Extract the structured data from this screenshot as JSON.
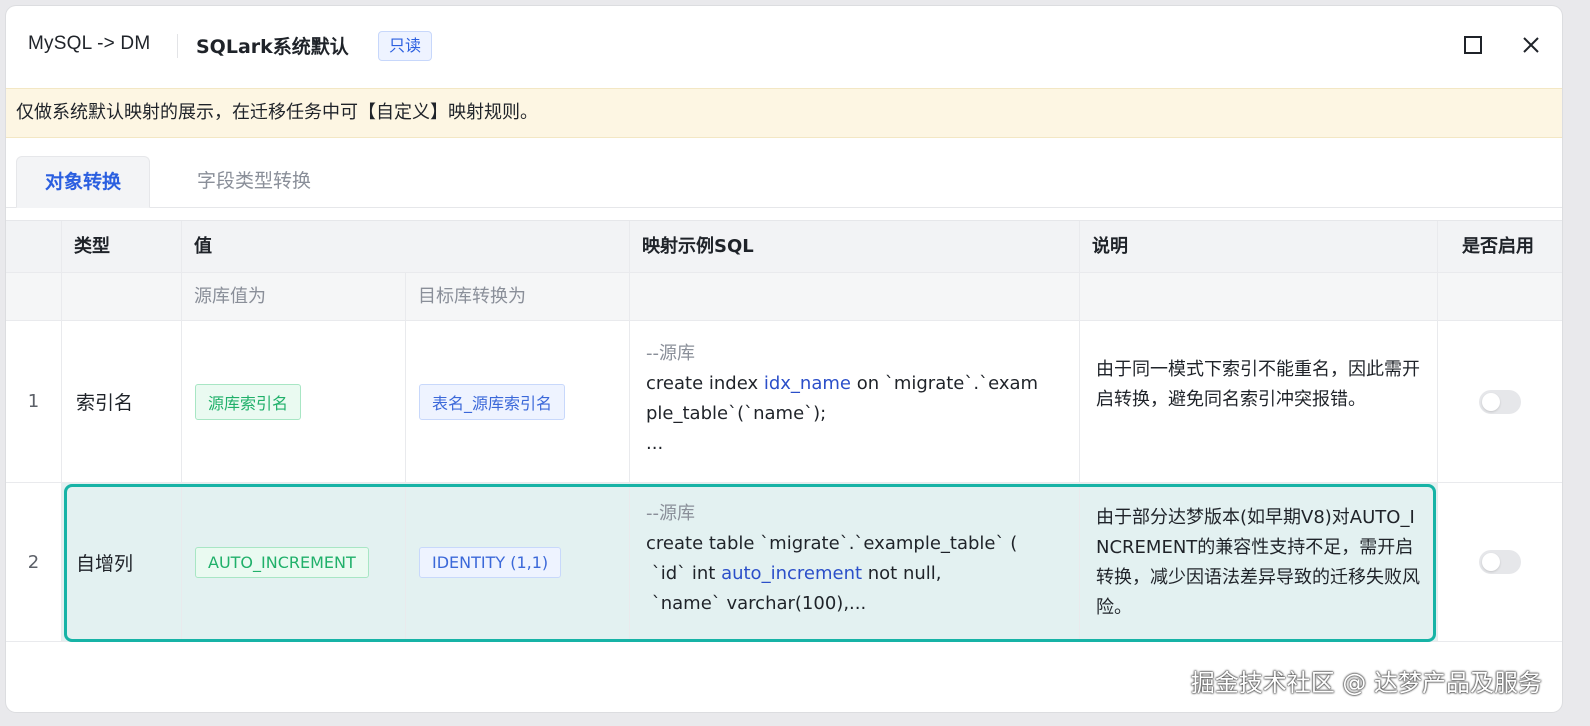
{
  "header": {
    "connection": "MySQL -> DM",
    "title": "SQLark系统默认",
    "badge": "只读",
    "maximize_icon": "maximize-icon",
    "close_icon": "close-icon"
  },
  "notice": "仅做系统默认映射的展示，在迁移任务中可【自定义】映射规则。",
  "tabs": [
    {
      "label": "对象转换",
      "active": true
    },
    {
      "label": "字段类型转换",
      "active": false
    }
  ],
  "table": {
    "columns": {
      "type": "类型",
      "value": "值",
      "sql": "映射示例SQL",
      "desc": "说明",
      "enabled": "是否启用"
    },
    "subheaders": {
      "source": "源库值为",
      "target": "目标库转换为"
    },
    "rows": [
      {
        "index": "1",
        "type": "索引名",
        "source_value": "源库索引名",
        "target_value": "表名_源库索引名",
        "sql": {
          "comment": "--源库",
          "line1_a": "create index ",
          "line1_kw": "idx_name",
          "line1_b": " on `migrate`.`exam",
          "line2": "ple_table`(`name`);",
          "line3": "..."
        },
        "description": "由于同一模式下索引不能重名，因此需开启转换，避免同名索引冲突报错。",
        "enabled": false
      },
      {
        "index": "2",
        "type": "自增列",
        "source_value": "AUTO_INCREMENT",
        "target_value": "IDENTITY (1,1)",
        "sql": {
          "comment": "--源库",
          "line1": "create table `migrate`.`example_table` (",
          "line2_a": " `id` int ",
          "line2_kw": "auto_increment",
          "line2_b": " not null,",
          "line3": " `name` varchar(100),..."
        },
        "description": "由于部分达梦版本(如早期V8)对AUTO_INCREMENT的兼容性支持不足，需开启转换，减少因语法差异导致的迁移失败风险。",
        "enabled": false
      }
    ]
  },
  "watermark": "掘金技术社区 @ 达梦产品及服务",
  "colors": {
    "accent": "#2b5fe0",
    "highlight_border": "#17b3a6",
    "notice_bg": "#fdf6e3",
    "tag_green": "#20b06a"
  }
}
